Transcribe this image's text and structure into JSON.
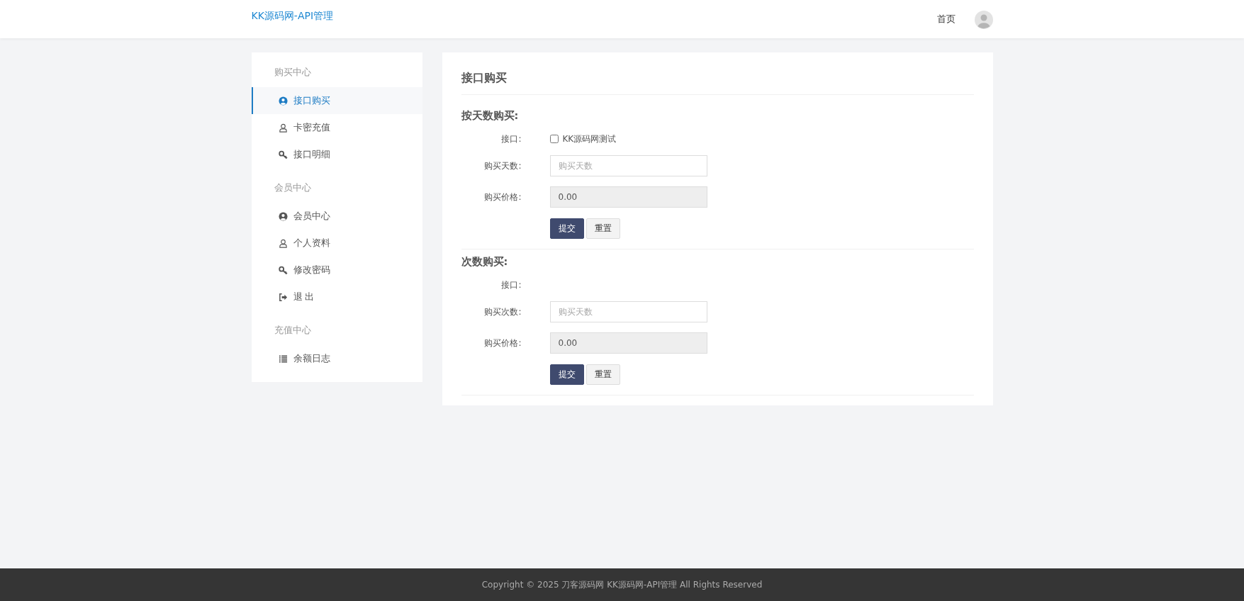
{
  "header": {
    "brand": "KK源码网-API管理",
    "nav": [
      {
        "label": "首页"
      }
    ]
  },
  "sidebar": {
    "groups": [
      {
        "title": "购买中心",
        "items": [
          {
            "label": "接口购买",
            "kind": "user-circle",
            "selected": true
          },
          {
            "label": "卡密充值",
            "kind": "user",
            "selected": false
          },
          {
            "label": "接口明细",
            "kind": "key",
            "selected": false
          }
        ]
      },
      {
        "title": "会员中心",
        "items": [
          {
            "label": "会员中心",
            "kind": "user-circle",
            "selected": false
          },
          {
            "label": "个人资料",
            "kind": "user",
            "selected": false
          },
          {
            "label": "修改密码",
            "kind": "key",
            "selected": false
          },
          {
            "label": "退 出",
            "kind": "sign-out",
            "selected": false
          }
        ]
      },
      {
        "title": "充值中心",
        "items": [
          {
            "label": "余额日志",
            "kind": "list",
            "selected": false
          }
        ]
      }
    ]
  },
  "main": {
    "title": "接口购买",
    "sections": [
      {
        "heading": "按天数购买:",
        "rows": [
          {
            "kind": "checkbox",
            "label": "接口:",
            "option": "KK源码网测试",
            "checked": false
          },
          {
            "kind": "input",
            "label": "购买天数:",
            "placeholder": "购买天数"
          },
          {
            "kind": "readonly",
            "label": "购买价格:",
            "value": "0.00"
          }
        ],
        "buttons": [
          {
            "label": "提交",
            "kind": "primary"
          },
          {
            "label": "重置",
            "kind": "default"
          }
        ]
      },
      {
        "heading": "次数购买:",
        "rows": [
          {
            "kind": "empty",
            "label": "接口:"
          },
          {
            "kind": "input",
            "label": "购买次数:",
            "placeholder": "购买天数"
          },
          {
            "kind": "readonly",
            "label": "购买价格:",
            "value": "0.00"
          }
        ],
        "buttons": [
          {
            "label": "提交",
            "kind": "primary"
          },
          {
            "label": "重置",
            "kind": "default"
          }
        ]
      }
    ]
  },
  "footer": {
    "text": "Copyright © 2025 刀客源码网 KK源码网-API管理 All Rights Reserved"
  }
}
